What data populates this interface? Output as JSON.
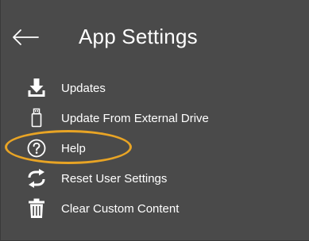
{
  "header": {
    "title": "App Settings",
    "back_icon": "arrow-left-icon"
  },
  "menu": {
    "items": [
      {
        "label": "Updates",
        "icon": "download-icon"
      },
      {
        "label": "Update From External Drive",
        "icon": "usb-drive-icon"
      },
      {
        "label": "Help",
        "icon": "help-circle-icon"
      },
      {
        "label": "Reset User Settings",
        "icon": "refresh-arrows-icon"
      },
      {
        "label": "Clear Custom Content",
        "icon": "trash-icon"
      }
    ]
  },
  "annotation": {
    "highlight_color": "#e8a425",
    "highlighted_item": "Help"
  },
  "colors": {
    "background": "#4a4a4a",
    "text": "#ffffff"
  }
}
